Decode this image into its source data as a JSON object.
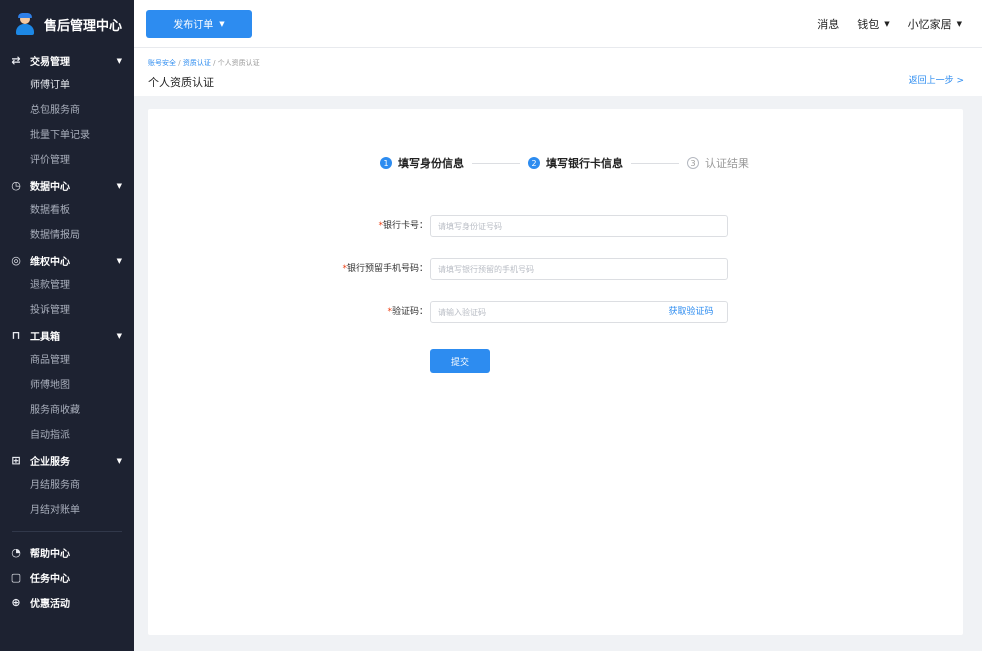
{
  "app": {
    "title": "售后管理中心"
  },
  "sidebar": {
    "groups": [
      {
        "icon": "swap-icon",
        "glyph": "⇄",
        "label": "交易管理",
        "items": [
          "师傅订单",
          "总包服务商",
          "批量下单记录",
          "评价管理"
        ]
      },
      {
        "icon": "clock-icon",
        "glyph": "◷",
        "label": "数据中心",
        "items": [
          "数据看板",
          "数据情报局"
        ]
      },
      {
        "icon": "shield-icon",
        "glyph": "◎",
        "label": "维权中心",
        "items": [
          "退款管理",
          "投诉管理"
        ]
      },
      {
        "icon": "toolbox-icon",
        "glyph": "⊓",
        "label": "工具箱",
        "items": [
          "商品管理",
          "师傅地图",
          "服务商收藏",
          "自动指派"
        ]
      },
      {
        "icon": "enterprise-icon",
        "glyph": "⊞",
        "label": "企业服务",
        "items": [
          "月结服务商",
          "月结对账单"
        ]
      }
    ],
    "extra": [
      {
        "icon": "help-icon",
        "glyph": "◔",
        "label": "帮助中心"
      },
      {
        "icon": "task-icon",
        "glyph": "▢",
        "label": "任务中心"
      },
      {
        "icon": "gift-icon",
        "glyph": "⊕",
        "label": "优惠活动"
      }
    ]
  },
  "topbar": {
    "publish_label": "发布订单",
    "messages_label": "消息",
    "wallet_label": "钱包",
    "user_label": "小忆家居"
  },
  "breadcrumb": {
    "items": [
      "账号安全",
      "资质认证",
      "个人资质认证"
    ],
    "separator": "/",
    "page_title": "个人资质认证",
    "back_label": "返回上一步 >"
  },
  "steps": [
    {
      "num": "1",
      "label": "填写身份信息",
      "state": "done"
    },
    {
      "num": "2",
      "label": "填写银行卡信息",
      "state": "current"
    },
    {
      "num": "3",
      "label": "认证结果",
      "state": "pending"
    }
  ],
  "form": {
    "bank_card": {
      "label": "银行卡号：",
      "placeholder": "请填写身份证号码",
      "value": ""
    },
    "phone": {
      "label": "银行预留手机号码：",
      "placeholder": "请填写银行预留的手机号码",
      "value": ""
    },
    "code": {
      "label": "验证码：",
      "placeholder": "请输入验证码",
      "value": "",
      "get_code_label": "获取验证码"
    },
    "required_mark": "*",
    "submit_label": "提交"
  },
  "colors": {
    "primary": "#2d8cf0",
    "sidebar_bg": "#1d2231",
    "required": "#ed4014"
  }
}
